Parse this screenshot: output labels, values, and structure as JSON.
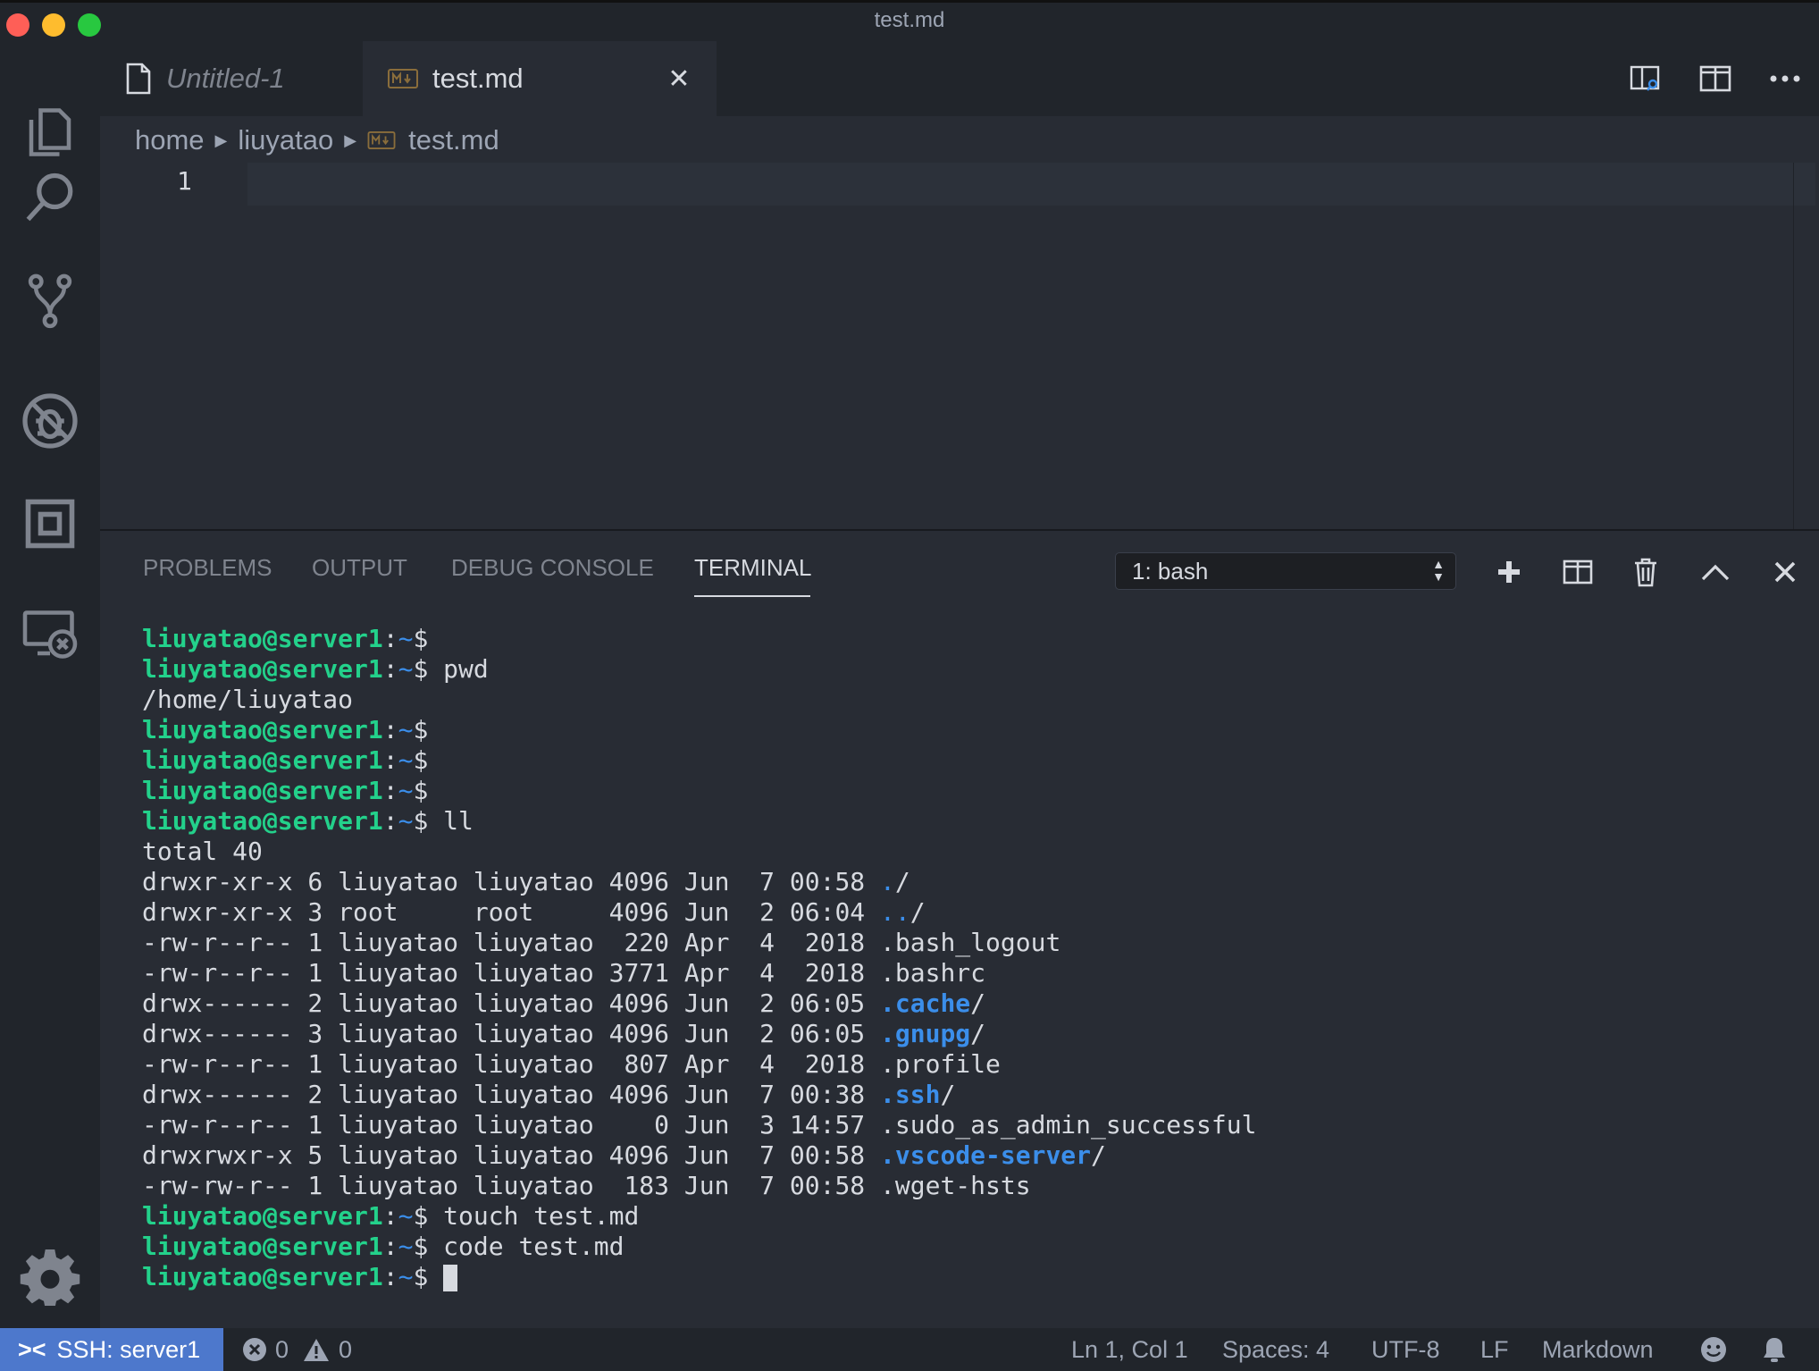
{
  "window": {
    "title": "test.md"
  },
  "activity_bar": {
    "items": [
      "files-icon",
      "search-icon",
      "source-control-icon",
      "debug-icon",
      "extensions-icon",
      "remote-explorer-icon"
    ],
    "bottom": "gear-icon"
  },
  "tabs": [
    {
      "label": "Untitled-1",
      "icon": "file-icon",
      "active": false
    },
    {
      "label": "test.md",
      "icon": "markdown-icon",
      "active": true
    }
  ],
  "tab_actions": [
    "open-preview-icon",
    "split-editor-icon",
    "more-actions-icon"
  ],
  "breadcrumb": [
    "home",
    "liuyatao",
    "test.md"
  ],
  "editor": {
    "line_numbers": [
      "1"
    ]
  },
  "panel": {
    "tabs": [
      "PROBLEMS",
      "OUTPUT",
      "DEBUG CONSOLE",
      "TERMINAL"
    ],
    "active_tab": "TERMINAL",
    "terminal_select": "1: bash",
    "actions": [
      "plus-icon",
      "split-terminal-icon",
      "trash-icon",
      "chevron-up-icon",
      "close-icon"
    ]
  },
  "terminal": {
    "prompt_user": "liuyatao@server1",
    "prompt_suffix": "$",
    "lines": [
      {
        "kind": "prompt",
        "cmd": ""
      },
      {
        "kind": "prompt",
        "cmd": " pwd"
      },
      {
        "kind": "out",
        "text": "/home/liuyatao"
      },
      {
        "kind": "prompt",
        "cmd": ""
      },
      {
        "kind": "prompt",
        "cmd": ""
      },
      {
        "kind": "prompt",
        "cmd": ""
      },
      {
        "kind": "prompt",
        "cmd": " ll"
      },
      {
        "kind": "out",
        "text": "total 40"
      },
      {
        "kind": "ls",
        "text": "drwxr-xr-x 6 liuyatao liuyatao 4096 Jun  7 00:58 ",
        "name": ".",
        "nstyle": "dir",
        "suffix": "/"
      },
      {
        "kind": "ls",
        "text": "drwxr-xr-x 3 root     root     4096 Jun  2 06:04 ",
        "name": "..",
        "nstyle": "dir",
        "suffix": "/"
      },
      {
        "kind": "ls",
        "text": "-rw-r--r-- 1 liuyatao liuyatao  220 Apr  4  2018 ",
        "name": ".bash_logout",
        "nstyle": "plain",
        "suffix": ""
      },
      {
        "kind": "ls",
        "text": "-rw-r--r-- 1 liuyatao liuyatao 3771 Apr  4  2018 ",
        "name": ".bashrc",
        "nstyle": "plain",
        "suffix": ""
      },
      {
        "kind": "ls",
        "text": "drwx------ 2 liuyatao liuyatao 4096 Jun  2 06:05 ",
        "name": ".cache",
        "nstyle": "dirb",
        "suffix": "/"
      },
      {
        "kind": "ls",
        "text": "drwx------ 3 liuyatao liuyatao 4096 Jun  2 06:05 ",
        "name": ".gnupg",
        "nstyle": "dirb",
        "suffix": "/"
      },
      {
        "kind": "ls",
        "text": "-rw-r--r-- 1 liuyatao liuyatao  807 Apr  4  2018 ",
        "name": ".profile",
        "nstyle": "plain",
        "suffix": ""
      },
      {
        "kind": "ls",
        "text": "drwx------ 2 liuyatao liuyatao 4096 Jun  7 00:38 ",
        "name": ".ssh",
        "nstyle": "dirb",
        "suffix": "/"
      },
      {
        "kind": "ls",
        "text": "-rw-r--r-- 1 liuyatao liuyatao    0 Jun  3 14:57 ",
        "name": ".sudo_as_admin_successful",
        "nstyle": "plain",
        "suffix": ""
      },
      {
        "kind": "ls",
        "text": "drwxrwxr-x 5 liuyatao liuyatao 4096 Jun  7 00:58 ",
        "name": ".vscode-server",
        "nstyle": "dirb",
        "suffix": "/"
      },
      {
        "kind": "ls",
        "text": "-rw-rw-r-- 1 liuyatao liuyatao  183 Jun  7 00:58 ",
        "name": ".wget-hsts",
        "nstyle": "plain",
        "suffix": ""
      },
      {
        "kind": "prompt",
        "cmd": " touch test.md"
      },
      {
        "kind": "prompt",
        "cmd": " code test.md"
      },
      {
        "kind": "prompt",
        "cmd": " ",
        "cursor": true
      }
    ]
  },
  "status_bar": {
    "remote": "SSH: server1",
    "errors": "0",
    "warnings": "0",
    "position": "Ln 1, Col 1",
    "spaces": "Spaces: 4",
    "encoding": "UTF-8",
    "eol": "LF",
    "language": "Markdown",
    "icons": [
      "feedback-smiley-icon",
      "notifications-bell-icon"
    ]
  },
  "colors": {
    "prompt_green": "#23d18b",
    "dir_blue": "#3b8eea",
    "remote_badge": "#4d78cc",
    "background": "#282c34"
  }
}
